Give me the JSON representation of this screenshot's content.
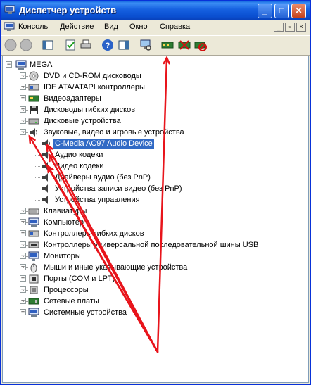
{
  "window": {
    "title": "Диспетчер устройств",
    "buttons": {
      "minimize": "_",
      "maximize": "□",
      "close": "✕"
    }
  },
  "menubar": {
    "items": [
      {
        "label": "Консоль"
      },
      {
        "label": "Действие"
      },
      {
        "label": "Вид"
      },
      {
        "label": "Окно"
      },
      {
        "label": "Справка"
      }
    ],
    "mdi": {
      "minimize": "_",
      "restore": "▫",
      "close": "×"
    }
  },
  "toolbar": {
    "tools": [
      {
        "icon": "back-icon"
      },
      {
        "icon": "forward-icon"
      },
      {
        "icon": "show-hide-tree-icon"
      },
      {
        "icon": "properties-icon"
      },
      {
        "icon": "print-icon"
      },
      {
        "icon": "help-icon"
      },
      {
        "icon": "action-pane-icon"
      },
      {
        "icon": "scan-hardware-icon"
      },
      {
        "icon": "update-driver-icon"
      },
      {
        "icon": "disable-device-icon"
      },
      {
        "icon": "uninstall-device-icon"
      }
    ]
  },
  "tree": {
    "root": {
      "label": "MEGA",
      "expander": "−",
      "icon": "computer-icon"
    },
    "categories": [
      {
        "label": "DVD и CD-ROM дисководы",
        "expander": "+",
        "icon": "dvd-drive-icon"
      },
      {
        "label": "IDE ATA/ATAPI контроллеры",
        "expander": "+",
        "icon": "ide-controller-icon"
      },
      {
        "label": "Видеоадаптеры",
        "expander": "+",
        "icon": "display-adapter-icon"
      },
      {
        "label": "Дисководы гибких дисков",
        "expander": "+",
        "icon": "floppy-drive-icon"
      },
      {
        "label": "Дисковые устройства",
        "expander": "+",
        "icon": "disk-drive-icon"
      },
      {
        "label": "Звуковые, видео и игровые устройства",
        "expander": "−",
        "icon": "sound-device-icon",
        "children": [
          {
            "label": "C-Media AC97 Audio Device",
            "selected": true,
            "icon": "audio-device-icon"
          },
          {
            "label": "Аудио кодеки",
            "icon": "audio-codec-icon"
          },
          {
            "label": "Видео кодеки",
            "icon": "video-codec-icon"
          },
          {
            "label": "Драйверы аудио (без PnP)",
            "icon": "legacy-audio-driver-icon"
          },
          {
            "label": "Устройства записи видео (без PnP)",
            "icon": "video-capture-icon"
          },
          {
            "label": "Устройства управления",
            "icon": "media-control-icon"
          }
        ]
      },
      {
        "label": "Клавиатуры",
        "expander": "+",
        "icon": "keyboard-icon"
      },
      {
        "label": "Компьютер",
        "expander": "+",
        "icon": "computer-icon"
      },
      {
        "label": "Контроллеры гибких дисков",
        "expander": "+",
        "icon": "floppy-controller-icon"
      },
      {
        "label": "Контроллеры универсальной последовательной шины USB",
        "expander": "+",
        "icon": "usb-controller-icon"
      },
      {
        "label": "Мониторы",
        "expander": "+",
        "icon": "monitor-icon"
      },
      {
        "label": "Мыши и иные указывающие устройства",
        "expander": "+",
        "icon": "mouse-icon"
      },
      {
        "label": "Порты (COM и LPT)",
        "expander": "+",
        "icon": "port-icon"
      },
      {
        "label": "Процессоры",
        "expander": "+",
        "icon": "processor-icon"
      },
      {
        "label": "Сетевые платы",
        "expander": "+",
        "icon": "network-card-icon"
      },
      {
        "label": "Системные устройства",
        "expander": "+",
        "icon": "system-device-icon"
      }
    ]
  },
  "annotations": {
    "arrow_color": "#e8141b"
  }
}
